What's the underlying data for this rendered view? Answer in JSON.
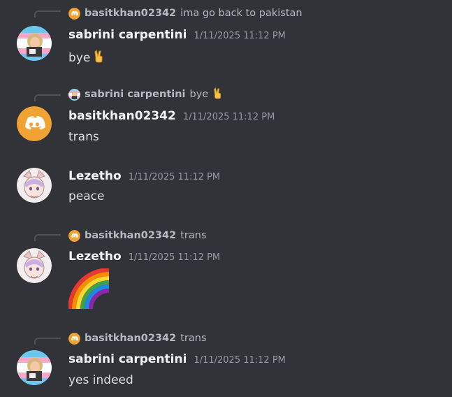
{
  "messages": [
    {
      "reply": {
        "username": "basitkhan02342",
        "text": "ima go back to pakistan",
        "avatar": "discord-logo-icon"
      },
      "author": "sabrini carpentini",
      "timestamp": "1/11/2025 11:12 PM",
      "content": "bye",
      "content_emoji": "victory-hand-icon",
      "avatar": "sabrini-avatar"
    },
    {
      "reply": {
        "username": "sabrini carpentini",
        "text": "bye",
        "avatar": "sabrini-avatar",
        "emoji": "victory-hand-icon"
      },
      "author": "basitkhan02342",
      "timestamp": "1/11/2025 11:12 PM",
      "content": "trans",
      "avatar": "discord-logo-icon"
    },
    {
      "author": "Lezetho",
      "timestamp": "1/11/2025 11:12 PM",
      "content": "peace",
      "avatar": "lezetho-avatar"
    },
    {
      "reply": {
        "username": "basitkhan02342",
        "text": "trans",
        "avatar": "discord-logo-icon"
      },
      "author": "Lezetho",
      "timestamp": "1/11/2025 11:12 PM",
      "content_emoji": "rainbow-icon",
      "avatar": "lezetho-avatar"
    },
    {
      "reply": {
        "username": "basitkhan02342",
        "text": "trans",
        "avatar": "discord-logo-icon"
      },
      "author": "sabrini carpentini",
      "timestamp": "1/11/2025 11:12 PM",
      "content": "yes indeed",
      "avatar": "sabrini-avatar"
    }
  ],
  "colors": {
    "background": "#313338",
    "discord_orange": "#f0a232",
    "username": "#f2f3f5",
    "muted": "#949ba4"
  }
}
